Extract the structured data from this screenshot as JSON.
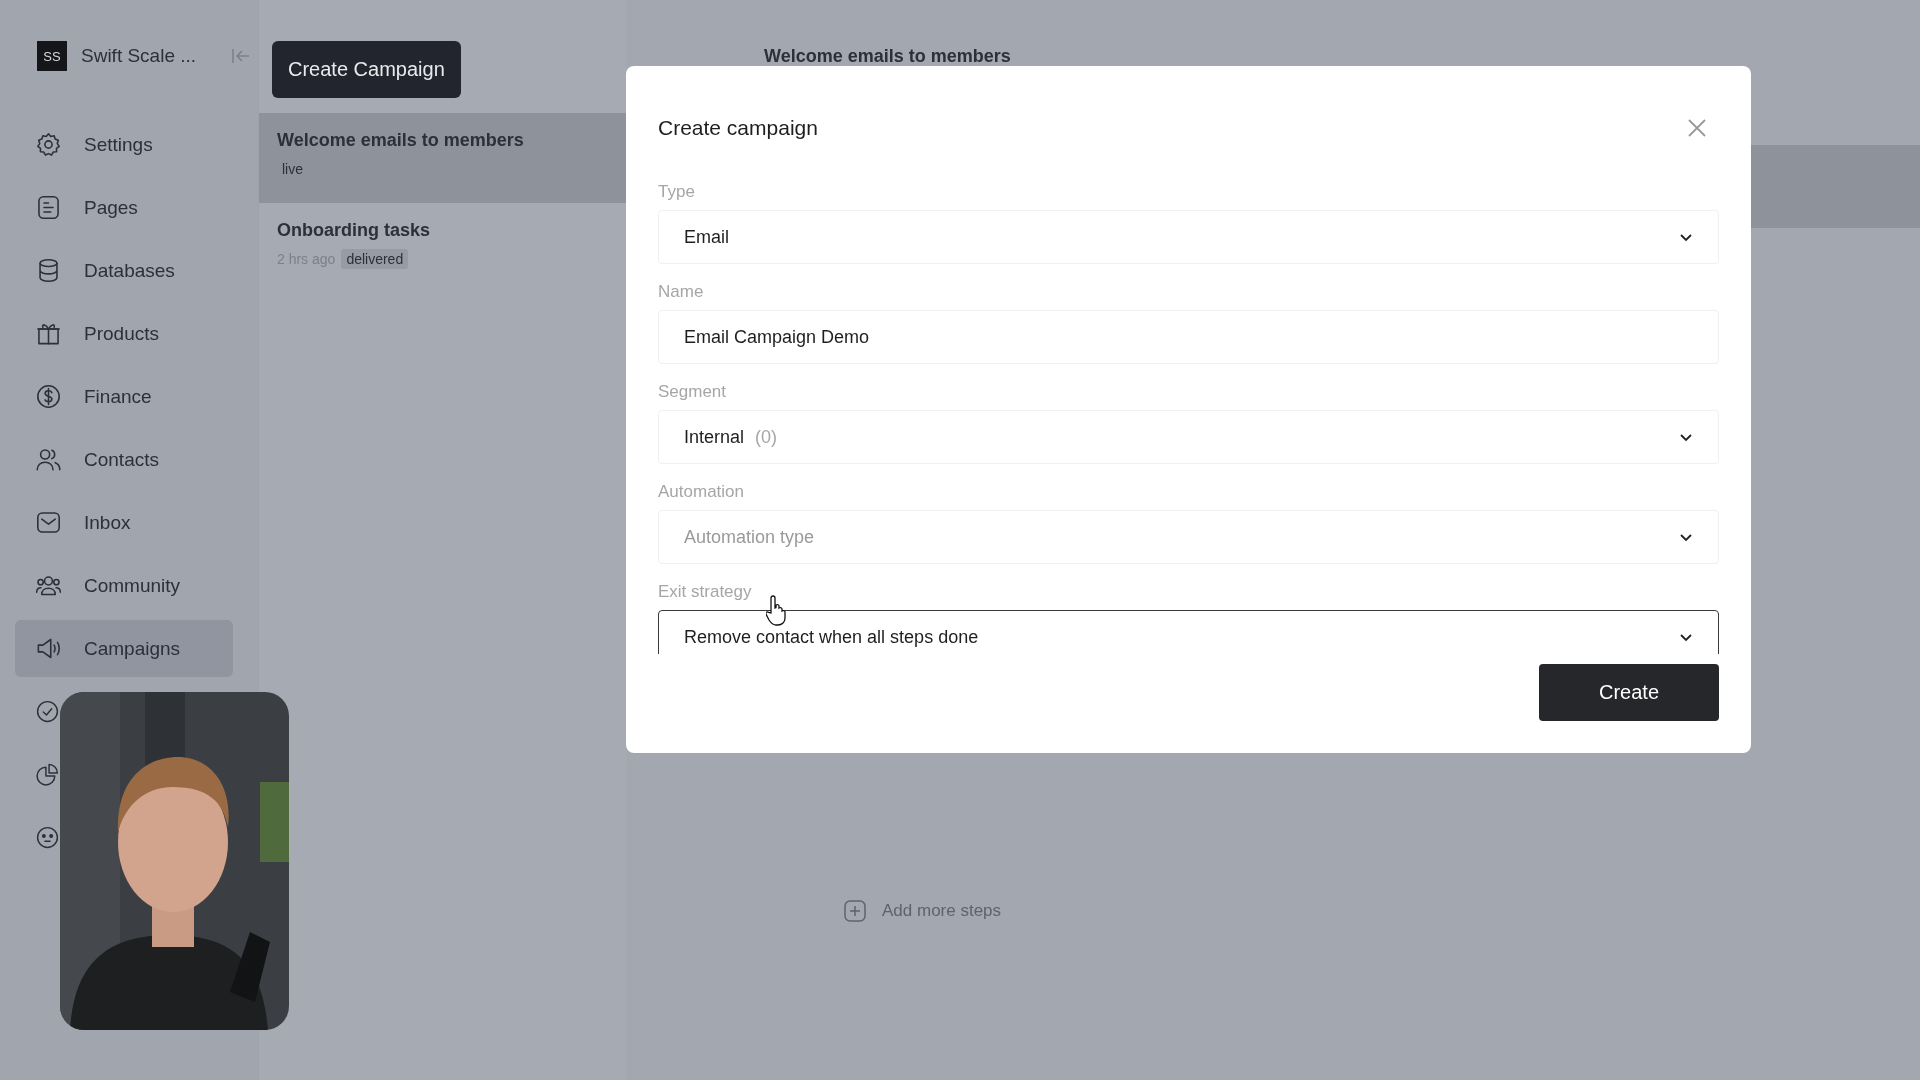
{
  "workspace": {
    "initials": "SS",
    "name": "Swift Scale ..."
  },
  "nav": [
    {
      "kind": "settings",
      "label": "Settings",
      "selected": false
    },
    {
      "kind": "pages",
      "label": "Pages",
      "selected": false
    },
    {
      "kind": "databases",
      "label": "Databases",
      "selected": false
    },
    {
      "kind": "products",
      "label": "Products",
      "selected": false
    },
    {
      "kind": "finance",
      "label": "Finance",
      "selected": false
    },
    {
      "kind": "contacts",
      "label": "Contacts",
      "selected": false
    },
    {
      "kind": "inbox",
      "label": "Inbox",
      "selected": false
    },
    {
      "kind": "community",
      "label": "Community",
      "selected": false
    },
    {
      "kind": "campaigns",
      "label": "Campaigns",
      "selected": true
    },
    {
      "kind": "check",
      "selected": false
    },
    {
      "kind": "pie",
      "selected": false
    },
    {
      "kind": "smiley",
      "selected": false
    }
  ],
  "create_campaign_button": "Create Campaign",
  "campaigns": [
    {
      "title": "Welcome emails to members",
      "status": "live",
      "selected": true
    },
    {
      "title": "Onboarding tasks",
      "time": "2 hrs ago",
      "status": "delivered",
      "selected": false
    }
  ],
  "detail": {
    "title": "Welcome emails to members",
    "add_step": "Add more steps"
  },
  "modal": {
    "title": "Create campaign",
    "fields": [
      {
        "label": "Type",
        "kind": "select",
        "value": "Email",
        "focused": false
      },
      {
        "label": "Name",
        "kind": "text",
        "value": "Email Campaign Demo",
        "focused": false
      },
      {
        "label": "Segment",
        "kind": "select",
        "value": "Internal",
        "count": "(0)",
        "focused": false
      },
      {
        "label": "Automation",
        "kind": "select",
        "placeholder": "Automation type",
        "focused": false
      },
      {
        "label": "Exit strategy",
        "kind": "select",
        "value": "Remove contact when all steps done",
        "focused": true
      }
    ],
    "submit": "Create"
  }
}
